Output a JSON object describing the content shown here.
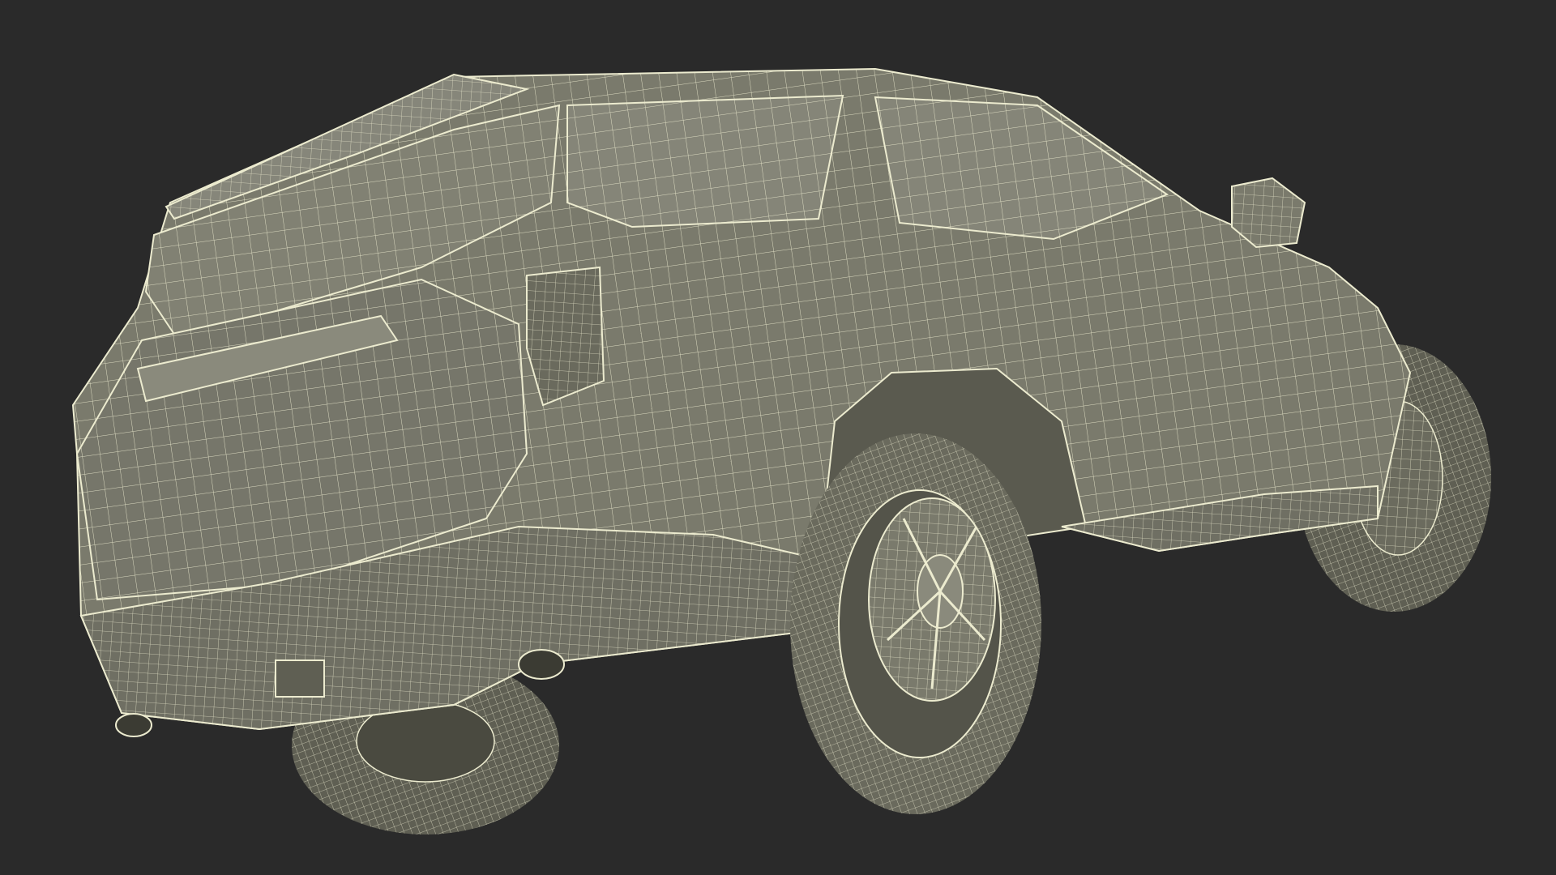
{
  "viewport": {
    "background_color": "#2a2a2a"
  },
  "model": {
    "subject": "suv-wireframe-rear-three-quarter",
    "body_color": "#7a7a6c",
    "body_shade_color": "#5f5f53",
    "dark_color": "#3b3b33",
    "wire_color": "#ecebcf",
    "glass_color": "#8a8a7a"
  }
}
